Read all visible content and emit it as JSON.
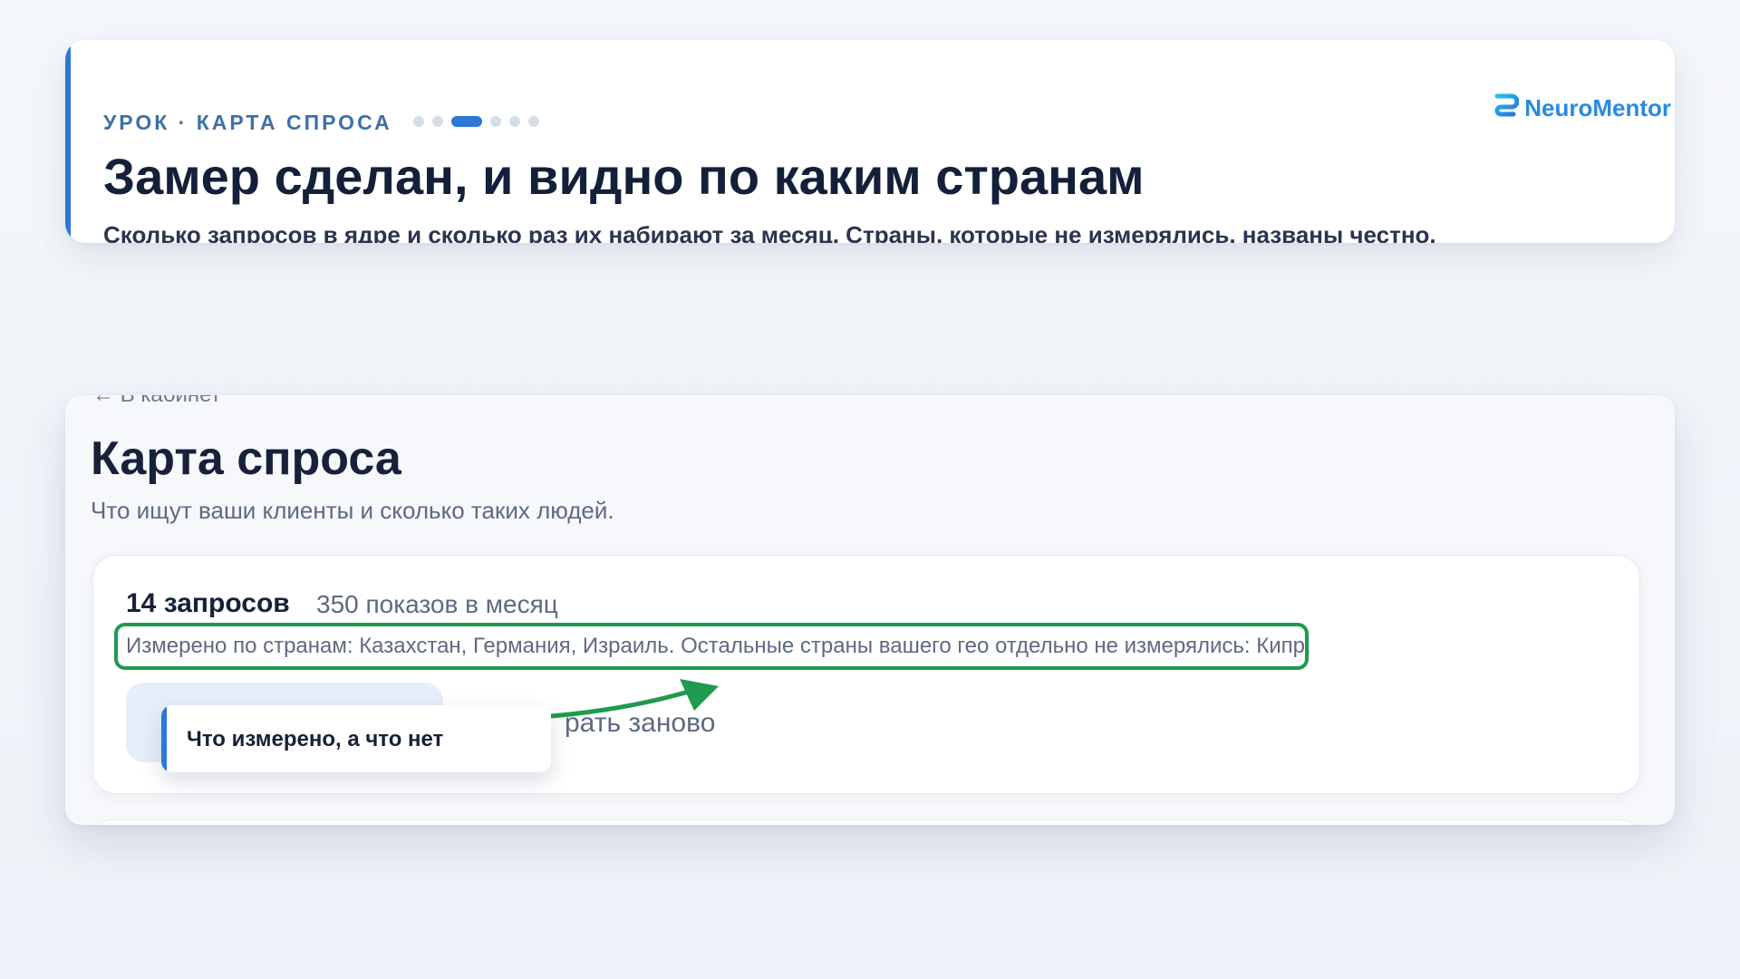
{
  "lesson": {
    "kicker": "УРОК · КАРТА СПРОСА",
    "progress": {
      "total": 6,
      "current": 3
    },
    "title": "Замер сделан, и видно по каким странам",
    "subtitle": "Сколько запросов в ядре и сколько раз их набирают за месяц. Страны, которые не измерялись, названы честно."
  },
  "brand": {
    "name": "NeuroMentor",
    "icon": "neuromentor-logo-icon",
    "color": "#2a8ae0"
  },
  "app": {
    "back_link": "← В кабинет",
    "page_title": "Карта спроса",
    "page_subtitle": "Что ищут ваши клиенты и сколько таких людей.",
    "result": {
      "query_count": "14 запросов",
      "impressions": "350 показов в месяц",
      "measured_note": "Измерено по странам: Казахстан, Германия, Израиль. Остальные страны вашего гео отдельно не измерялись: Кипр.",
      "restart_label": "рать заново"
    }
  },
  "annotation": {
    "callout": "Что измерено, а что нет",
    "highlight_color": "#1f9a4e",
    "accent_color": "#2b78d6"
  }
}
